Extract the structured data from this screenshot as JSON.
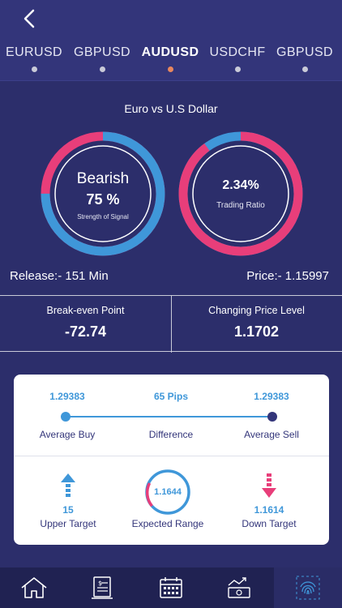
{
  "tabs": [
    {
      "label": "EURUSD",
      "active": false
    },
    {
      "label": "GBPUSD",
      "active": false
    },
    {
      "label": "AUDUSD",
      "active": true
    },
    {
      "label": "USDCHF",
      "active": false
    },
    {
      "label": "GBPUSD",
      "active": false
    }
  ],
  "title": "Euro vs U.S Dollar",
  "signal": {
    "label": "Bearish",
    "value": "75 %",
    "sub": "Strength of Signal",
    "fraction": 0.75
  },
  "ratio": {
    "value": "2.34%",
    "sub": "Trading Ratio",
    "fraction": 0.9
  },
  "release": "Release:- 151 Min",
  "price": "Price:- 1.15997",
  "break_even": {
    "label": "Break-even Point",
    "value": "-72.74"
  },
  "changing_price": {
    "label": "Changing Price Level",
    "value": "1.1702"
  },
  "card": {
    "avg_buy": {
      "value": "1.29383",
      "label": "Average Buy"
    },
    "difference": {
      "value": "65 Pips",
      "label": "Difference"
    },
    "avg_sell": {
      "value": "1.29383",
      "label": "Average Sell"
    },
    "upper": {
      "value": "15",
      "label": "Upper Target"
    },
    "expected": {
      "value": "1.1644",
      "label": "Expected Range"
    },
    "down": {
      "value": "1.1614",
      "label": "Down Target"
    }
  },
  "nav": [
    "home-icon",
    "invoice-icon",
    "calendar-icon",
    "money-chart-icon",
    "fingerprint-icon"
  ],
  "colors": {
    "background": "#2c2e6b",
    "pink": "#e83e7a",
    "blue": "#3f97d9",
    "navbar": "#202252"
  }
}
